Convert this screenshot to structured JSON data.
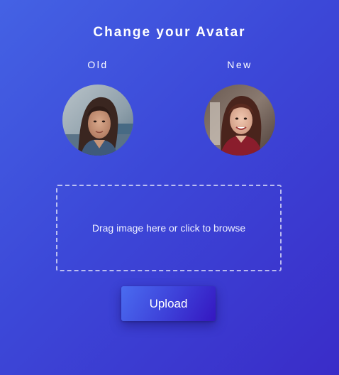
{
  "header": {
    "title": "Change your Avatar"
  },
  "avatars": {
    "old_label": "Old",
    "new_label": "New"
  },
  "dropzone": {
    "text": "Drag image here or click to browse"
  },
  "actions": {
    "upload_label": "Upload"
  },
  "colors": {
    "background_start": "#4462e4",
    "background_end": "#3a2cc8",
    "button_start": "#4a6cf0",
    "button_end": "#3516c0",
    "text": "#ffffff"
  }
}
